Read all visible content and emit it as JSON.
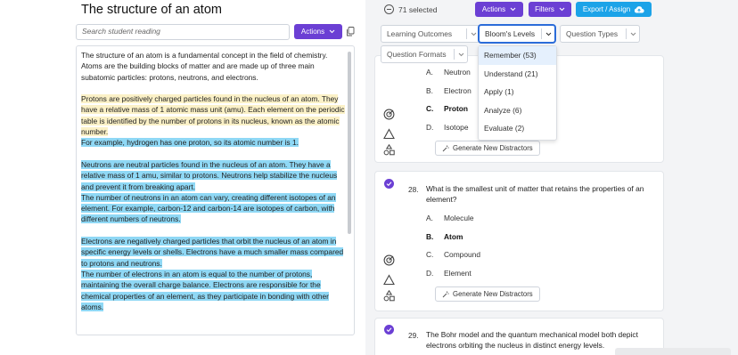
{
  "left": {
    "title": "The structure of an atom",
    "search_placeholder": "Search student reading",
    "actions_label": "Actions",
    "reading": {
      "p1": "The structure of an atom is a fundamental concept in the field of chemistry. Atoms are the building blocks of matter and are made up of three main subatomic particles: protons, neutrons, and electrons.",
      "p2a": "Protons are positively charged particles found in the nucleus of an atom. They have a relative mass of 1 atomic mass unit (amu). Each element on the periodic table is identified by the number of protons in its nucleus, known as the atomic number.",
      "p2b": "For example, hydrogen has one proton, so its atomic number is 1.",
      "p3a": "Neutrons are neutral particles found in the nucleus of an atom. They have a relative mass of 1 amu, similar to protons. Neutrons help stabilize the nucleus and prevent it from breaking apart.",
      "p3b": "The number of neutrons in an atom can vary, creating different isotopes of an element. For example, carbon-12 and carbon-14 are isotopes of carbon, with different numbers of neutrons.",
      "p4a": "Electrons are negatively charged particles that orbit the nucleus of an atom in specific energy levels or shells. Electrons have a much smaller mass compared to protons and neutrons.",
      "p4b": "The number of electrons in an atom is equal to the number of protons, maintaining the overall charge balance. Electrons are responsible for the chemical properties of an element, as they participate in bonding with other atoms."
    }
  },
  "right": {
    "selected": "71 selected",
    "actions_label": "Actions",
    "filters_label": "Filters",
    "export_label": "Export / Assign",
    "filters": {
      "learning_outcomes": "Learning Outcomes",
      "blooms_levels": "Bloom's Levels",
      "question_types": "Question Types",
      "question_formats": "Question Formats"
    },
    "dropdown": [
      "Remember (53)",
      "Understand (21)",
      "Apply (1)",
      "Analyze (6)",
      "Evaluate (2)"
    ],
    "q27": {
      "options": [
        {
          "letter": "A.",
          "text": "Neutron"
        },
        {
          "letter": "B.",
          "text": "Electron"
        },
        {
          "letter": "C.",
          "text": "Proton"
        },
        {
          "letter": "D.",
          "text": "Isotope"
        }
      ],
      "gen_label": "Generate New Distractors"
    },
    "q28": {
      "number": "28.",
      "text": "What is the smallest unit of matter that retains the properties of an element?",
      "options": [
        {
          "letter": "A.",
          "text": "Molecule"
        },
        {
          "letter": "B.",
          "text": "Atom"
        },
        {
          "letter": "C.",
          "text": "Compound"
        },
        {
          "letter": "D.",
          "text": "Element"
        }
      ],
      "gen_label": "Generate New Distractors"
    },
    "q29": {
      "number": "29.",
      "text": "The Bohr model and the quantum mechanical model both depict electrons orbiting the nucleus in distinct energy levels."
    }
  },
  "colors": {
    "purple": "#6b3fd4",
    "blue": "#1ca3e8",
    "highlight_yellow": "#fbf1c7",
    "highlight_blue": "#8fd8f5"
  }
}
